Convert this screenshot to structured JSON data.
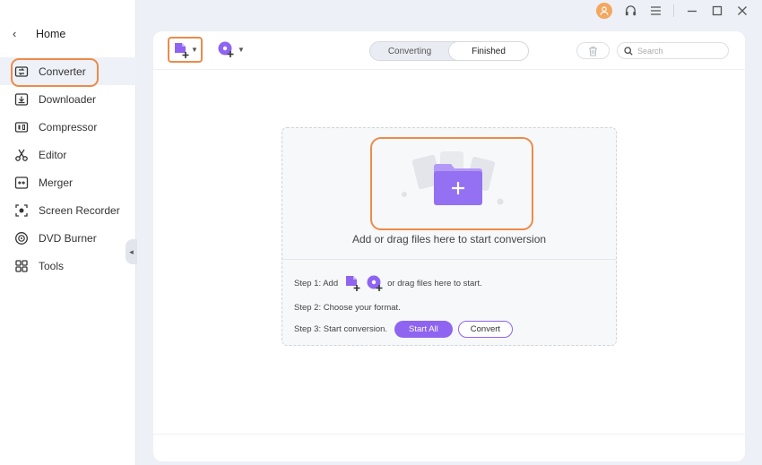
{
  "window": {
    "controls": [
      "user-icon",
      "headset-icon",
      "menu-icon",
      "minimize-icon",
      "maximize-icon",
      "close-icon"
    ]
  },
  "sidebar": {
    "home_label": "Home",
    "items": [
      {
        "label": "Converter",
        "icon": "converter-icon",
        "active": true
      },
      {
        "label": "Downloader",
        "icon": "download-icon"
      },
      {
        "label": "Compressor",
        "icon": "compress-icon"
      },
      {
        "label": "Editor",
        "icon": "scissors-icon"
      },
      {
        "label": "Merger",
        "icon": "merge-icon"
      },
      {
        "label": "Screen Recorder",
        "icon": "screen-record-icon"
      },
      {
        "label": "DVD Burner",
        "icon": "disc-icon"
      },
      {
        "label": "Tools",
        "icon": "grid-icon"
      }
    ]
  },
  "toolbar": {
    "tabs": [
      {
        "label": "Converting",
        "active": false
      },
      {
        "label": "Finished",
        "active": true
      }
    ],
    "search_placeholder": "Search"
  },
  "dropzone": {
    "text": "Add or drag files here to start conversion"
  },
  "steps": {
    "step1_prefix": "Step 1: Add",
    "step1_suffix": "or drag files here to start.",
    "step2": "Step 2: Choose your format.",
    "step3": "Step 3: Start conversion.",
    "start_all_label": "Start All",
    "convert_label": "Convert"
  },
  "colors": {
    "accent": "#8e64f0",
    "highlight": "#ec8b4a"
  }
}
